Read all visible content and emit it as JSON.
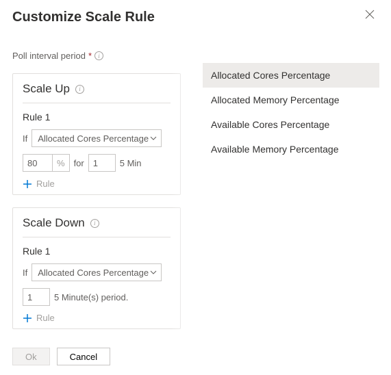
{
  "header": {
    "title": "Customize Scale Rule"
  },
  "poll": {
    "label": "Poll interval period",
    "required_marker": "*"
  },
  "scale_up": {
    "title": "Scale Up",
    "rule_label": "Rule 1",
    "if_text": "If",
    "metric_selected": "Allocated Cores Percentage",
    "threshold_value": "80",
    "percent_symbol": "%",
    "for_text": "for",
    "duration_value": "1",
    "period_suffix": "5 Min",
    "add_rule_label": "Rule"
  },
  "scale_down": {
    "title": "Scale Down",
    "rule_label": "Rule 1",
    "if_text": "If",
    "metric_selected": "Allocated Cores Percentage",
    "duration_value": "1",
    "period_suffix": "5 Minute(s) period.",
    "add_rule_label": "Rule"
  },
  "footer": {
    "ok_label": "Ok",
    "cancel_label": "Cancel"
  },
  "dropdown": {
    "items": [
      "Allocated Cores Percentage",
      "Allocated Memory Percentage",
      "Available Cores Percentage",
      "Available Memory Percentage"
    ]
  }
}
